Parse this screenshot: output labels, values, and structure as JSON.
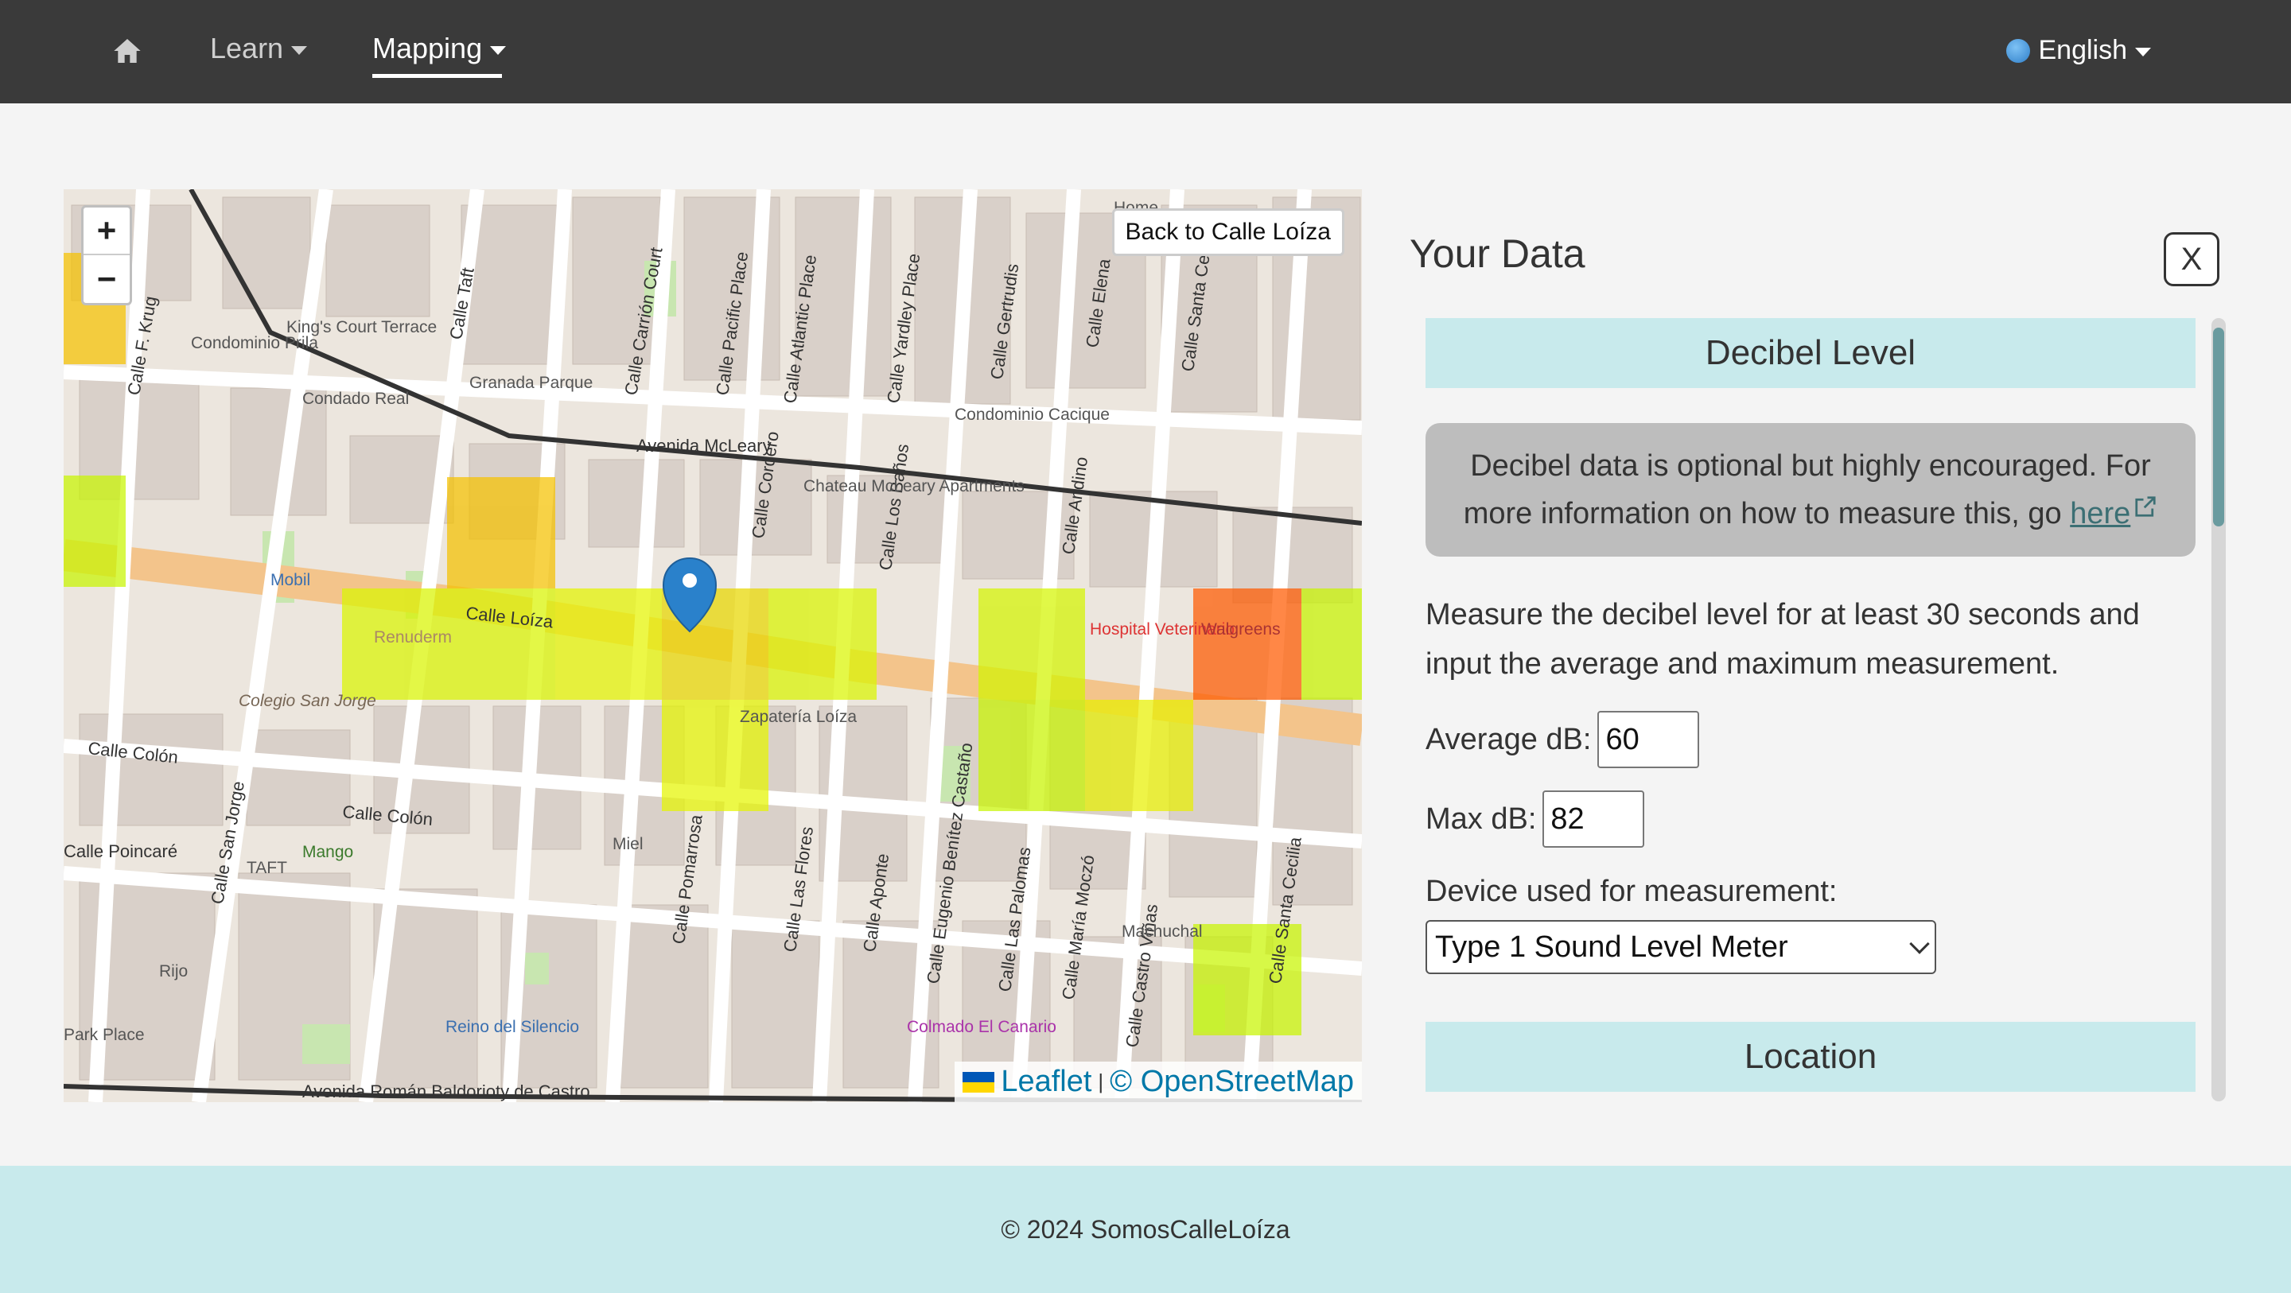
{
  "nav": {
    "learn_label": "Learn",
    "mapping_label": "Mapping",
    "language_label": "English"
  },
  "map": {
    "back_button_label": "Back to Calle Loíza",
    "zoom_in": "+",
    "zoom_out": "−",
    "attribution_leaflet": "Leaflet",
    "attribution_separator": "|",
    "attribution_osm": "© OpenStreetMap",
    "streets": {
      "avenida_mcleary": "Avenida McLeary",
      "calle_loiza": "Calle Loíza",
      "calle_colon": "Calle Colón",
      "calle_colon_2": "Calle Colón",
      "avenida_baldorioty": "Avenida Román Baldorioty de Castro",
      "calle_taft": "Calle Taft",
      "calle_krug": "Calle F. Krug",
      "calle_cordero": "Calle Cordero",
      "calle_los_banos": "Calle Los Baños",
      "calle_gertrudis": "Calle Gertrudis",
      "calle_elena": "Calle Elena",
      "calle_santa_cecilia": "Calle Santa Cecilia",
      "calle_las_flores": "Calle Las Flores",
      "calle_aponte": "Calle Aponte",
      "calle_las_palomas": "Calle Las Palomas",
      "calle_san_jorge": "Calle San Jorge",
      "calle_pomarrosa": "Calle Pomarrosa",
      "calle_carrion_court": "Calle Carrión Court",
      "calle_pacific_place": "Calle Pacific Place",
      "calle_atlantic_place": "Calle Atlantic Place",
      "calle_yardley_place": "Calle Yardley Place",
      "calle_poincare": "Calle Poincaré",
      "calle_andino": "Calle Andino",
      "calle_maria_moczo": "Calle María Moczó",
      "calle_castro_vinas": "Calle Castro Viñas",
      "calle_eugenio_benitez": "Calle Eugenio Benítez Castaño"
    },
    "places": {
      "condominio_prila": "Condominio Prila",
      "granada_parque": "Granada Parque",
      "condado_real": "Condado Real",
      "condominio_cacique": "Condominio Cacique",
      "chateau": "Chateau McLeary Apartments",
      "hospital": "Hospital Veterinario",
      "colegio": "Colegio San Jorge",
      "mango": "Mango",
      "reino": "Reino del Silencio",
      "machuchal": "Machuchal",
      "mobil": "Mobil",
      "kings_court": "King's Court Terrace",
      "taft": "TAFT",
      "miel": "Miel",
      "rijo": "Rijo",
      "park_place": "Park Place",
      "renuderm": "Renuderm",
      "walgreens": "Walgreens",
      "zapateria": "Zapatería Loíza",
      "colmado": "Colmado El Canario",
      "home": "Home"
    },
    "noise_cell_colors": {
      "moderate": "#f5d000",
      "low": "#d9f500",
      "lower": "#b8f500",
      "high": "#ff6a00"
    },
    "marker_color": "#2a81cb"
  },
  "panel": {
    "title": "Your Data",
    "close_label": "X",
    "decibel_header": "Decibel Level",
    "info_text": "Decibel data is optional but highly encouraged. For more information on how to measure this, go ",
    "info_link": "here",
    "instructions": "Measure the decibel level for at least 30 seconds and input the average and maximum measurement.",
    "avg_label": "Average dB:",
    "avg_value": "60",
    "max_label": "Max dB:",
    "max_value": "82",
    "device_label": "Device used for measurement:",
    "device_selected": "Type 1 Sound Level Meter",
    "location_header": "Location"
  },
  "footer": {
    "copyright": "© 2024 SomosCalleLoíza"
  }
}
